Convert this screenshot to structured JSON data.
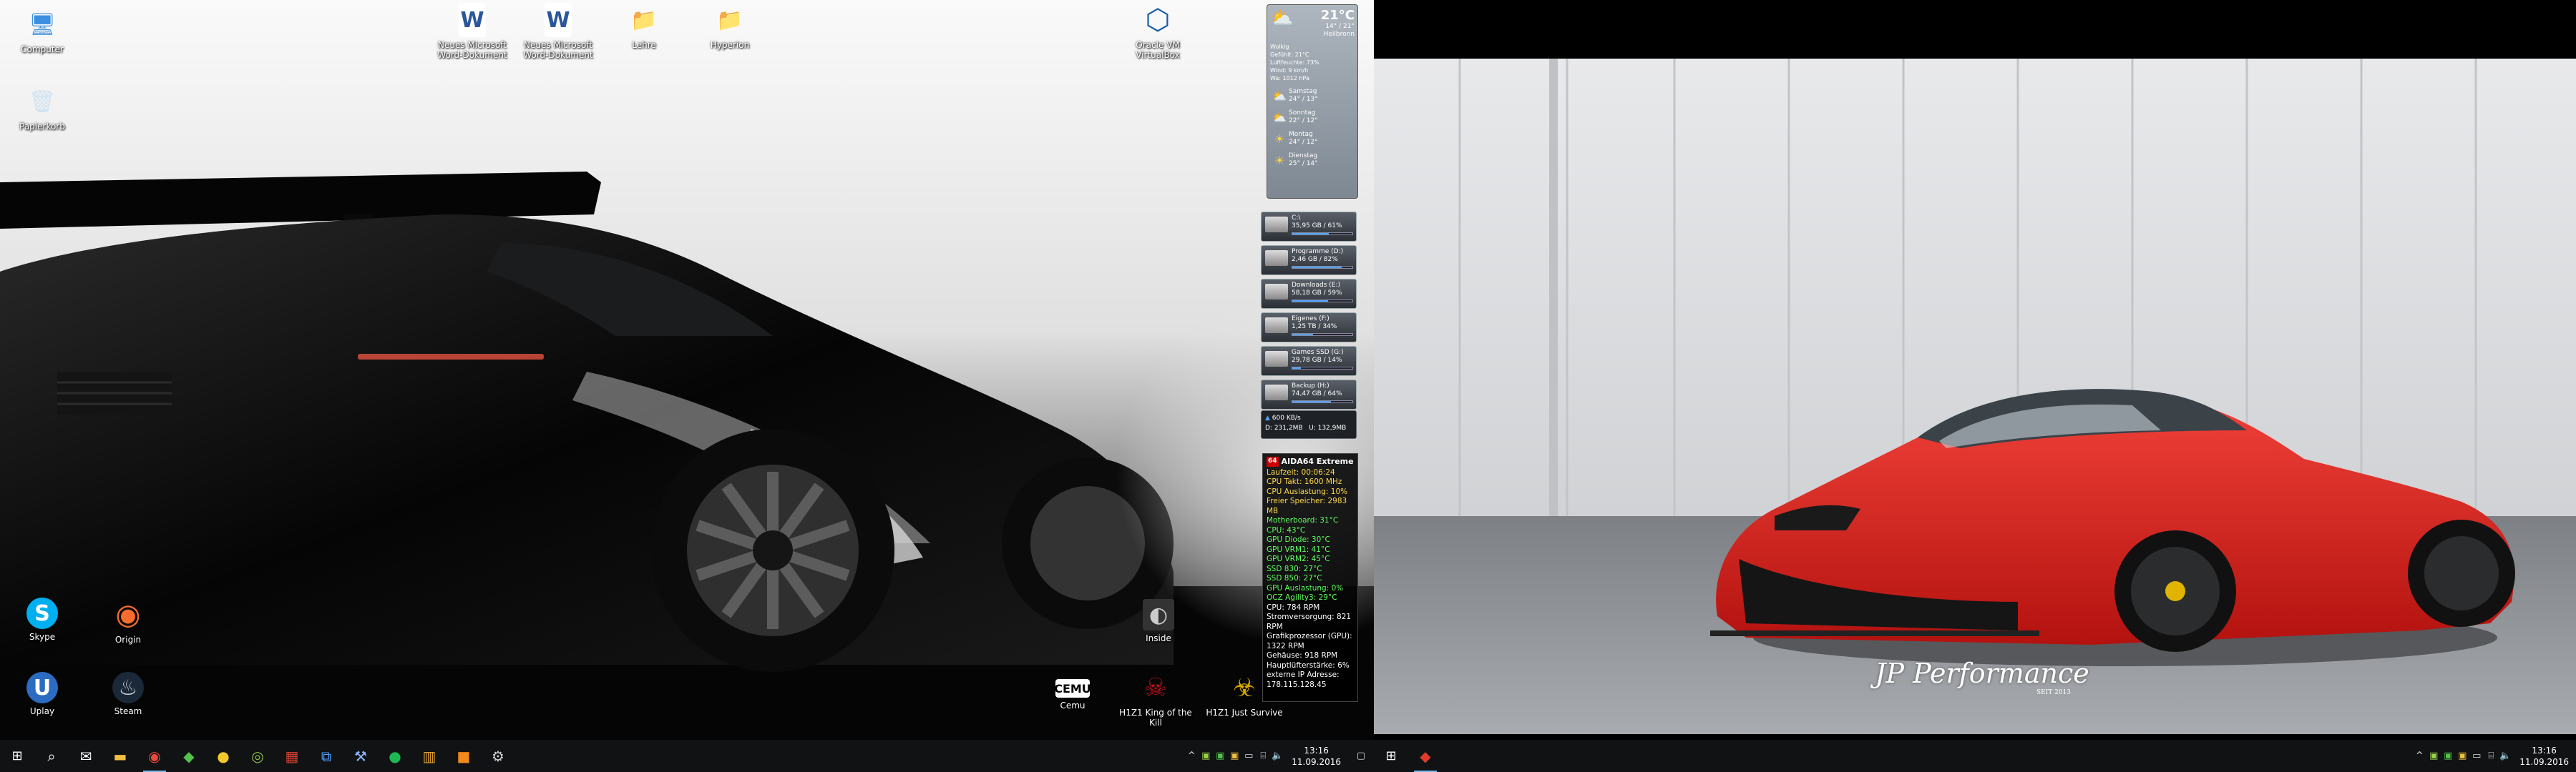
{
  "desktop_left": {
    "icons": [
      {
        "label": "Computer",
        "glyph": "🖥",
        "color": "#3b8fe0"
      },
      {
        "label": "Papierkorb",
        "glyph": "🗑",
        "color": "#bfd6e8"
      },
      {
        "label": "Skype",
        "glyph": "S",
        "color": "#00aff0"
      },
      {
        "label": "Origin",
        "glyph": "◉",
        "color": "#f56c2d"
      },
      {
        "label": "Uplay",
        "glyph": "U",
        "color": "#2b6cc2"
      },
      {
        "label": "Steam",
        "glyph": "♨",
        "color": "#1b2838"
      },
      {
        "label": "Neues Microsoft Word-Dokument",
        "glyph": "W",
        "color": "#2b579a"
      },
      {
        "label": "Neues Microsoft Word-Dokument",
        "glyph": "W",
        "color": "#2b579a"
      },
      {
        "label": "Lehre",
        "glyph": "📁",
        "color": "#e8c35a"
      },
      {
        "label": "Hyperion",
        "glyph": "📁",
        "color": "#e8c35a"
      },
      {
        "label": "Oracle VM VirtualBox",
        "glyph": "⬡",
        "color": "#1a5ea8"
      },
      {
        "label": "Cemu",
        "glyph": "C",
        "color": "#222"
      },
      {
        "label": "H1Z1 King of the Kill",
        "glyph": "☠",
        "color": "#b5121b"
      },
      {
        "label": "H1Z1 Just Survive",
        "glyph": "☣",
        "color": "#d8a800"
      },
      {
        "label": "Inside",
        "glyph": "◐",
        "color": "#333"
      }
    ]
  },
  "weather": {
    "temp": "21°C",
    "range": "14° / 21°",
    "location": "Heilbronn",
    "details": [
      "Wolkig",
      "Gefühlt: 21°C",
      "Luftfeuchte: 73%",
      "Wind: 9 km/h",
      "Wa: 1012 hPa"
    ],
    "forecast": [
      {
        "day": "Samstag",
        "temp": "24° / 13°",
        "icon": "cloud-sun-icon"
      },
      {
        "day": "Sonntag",
        "temp": "22° / 12°",
        "icon": "cloud-sun-icon"
      },
      {
        "day": "Montag",
        "temp": "24° / 12°",
        "icon": "sun-icon"
      },
      {
        "day": "Dienstag",
        "temp": "25° / 14°",
        "icon": "sun-icon"
      }
    ]
  },
  "drives": [
    {
      "name": "C:\\",
      "info": "35,95 GB / 61%",
      "pct": 61
    },
    {
      "name": "Programme (D:)",
      "info": "2,46 GB / 82%",
      "pct": 82
    },
    {
      "name": "Downloads (E:)",
      "info": "58,18 GB / 59%",
      "pct": 59
    },
    {
      "name": "Eigenes (F:)",
      "info": "1,25 TB / 34%",
      "pct": 34
    },
    {
      "name": "Games SSD (G:)",
      "info": "29,78 GB / 14%",
      "pct": 14
    },
    {
      "name": "Backup (H:)",
      "info": "74,47 GB / 64%",
      "pct": 64
    }
  ],
  "network": {
    "speed": "600 KB/s",
    "down": "D: 231,2MB",
    "up": "U: 132,9MB"
  },
  "aida": {
    "title": "AIDA64 Extreme",
    "badge": "64",
    "lines": [
      {
        "text": "Laufzeit: 00:06:24",
        "c": "y"
      },
      {
        "text": "CPU Takt: 1600 MHz",
        "c": "y"
      },
      {
        "text": "CPU Auslastung: 10%",
        "c": "y"
      },
      {
        "text": "Freier Speicher: 2983 MB",
        "c": "y"
      },
      {
        "text": "Motherboard: 31°C",
        "c": "g"
      },
      {
        "text": "CPU: 43°C",
        "c": "g"
      },
      {
        "text": "GPU Diode: 30°C",
        "c": "g"
      },
      {
        "text": "GPU VRM1: 41°C",
        "c": "g"
      },
      {
        "text": "GPU VRM2: 45°C",
        "c": "g"
      },
      {
        "text": "SSD 830: 27°C",
        "c": "g"
      },
      {
        "text": "SSD 850: 27°C",
        "c": "g"
      },
      {
        "text": "GPU Auslastung: 0%",
        "c": "g"
      },
      {
        "text": "OCZ Agility3: 29°C",
        "c": "g"
      },
      {
        "text": "CPU: 784 RPM",
        "c": "w"
      },
      {
        "text": "Stromversorgung: 821 RPM",
        "c": "w"
      },
      {
        "text": "Grafikprozessor (GPU): 1322 RPM",
        "c": "w"
      },
      {
        "text": "Gehäuse: 918 RPM",
        "c": "w"
      },
      {
        "text": "Hauptlüfterstärke: 6%",
        "c": "w"
      },
      {
        "text": "externe IP Adresse:",
        "c": "w"
      },
      {
        "text": "178.115.128.45",
        "c": "w"
      }
    ]
  },
  "taskbar_left": {
    "clock_time": "13:16",
    "clock_date": "11.09.2016"
  },
  "taskbar_right": {
    "clock_time": "13:16",
    "clock_date": "11.09.2016"
  },
  "wallpaper_right": {
    "brand": "JP Performance",
    "since": "SEIT 2013"
  }
}
